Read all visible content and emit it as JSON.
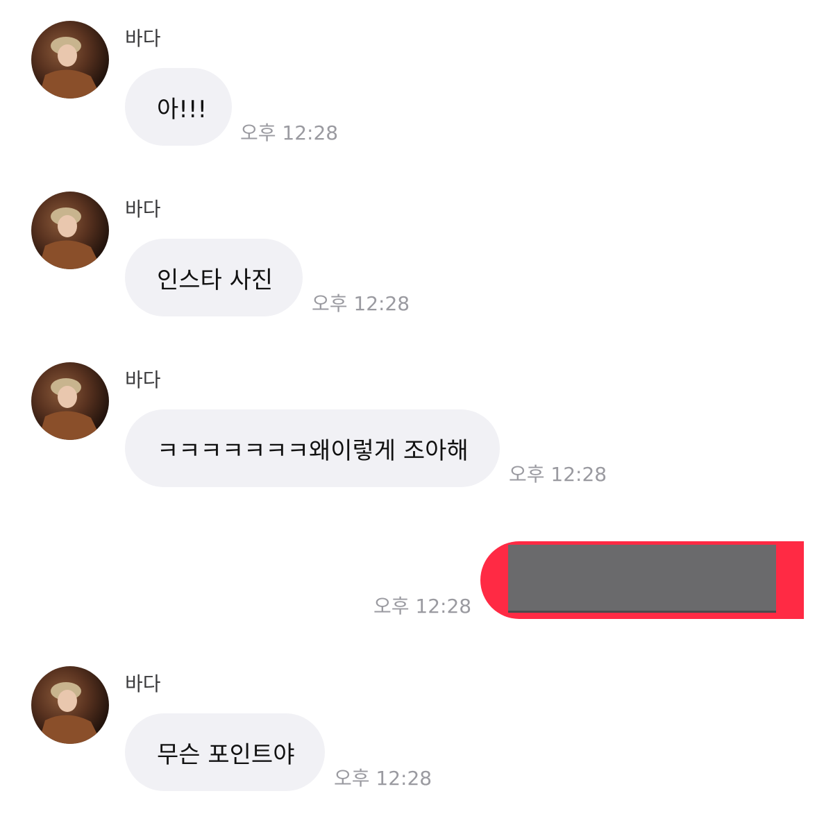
{
  "messages": [
    {
      "sender": "바다",
      "text": "아!!!",
      "time": "오후 12:28"
    },
    {
      "sender": "바다",
      "text": "인스타 사진",
      "time": "오후 12:28"
    },
    {
      "sender": "바다",
      "text": "ㅋㅋㅋㅋㅋㅋㅋ왜이렇게 조아해",
      "time": "오후 12:28"
    },
    {
      "sender": "me",
      "text": "",
      "time": "오후 12:28",
      "redacted": true
    },
    {
      "sender": "바다",
      "text": "무슨 포인트야",
      "time": "오후 12:28"
    }
  ],
  "colors": {
    "incoming_bubble": "#f1f1f5",
    "outgoing_bubble": "#ff2a44",
    "timestamp": "#9a9aa0"
  }
}
